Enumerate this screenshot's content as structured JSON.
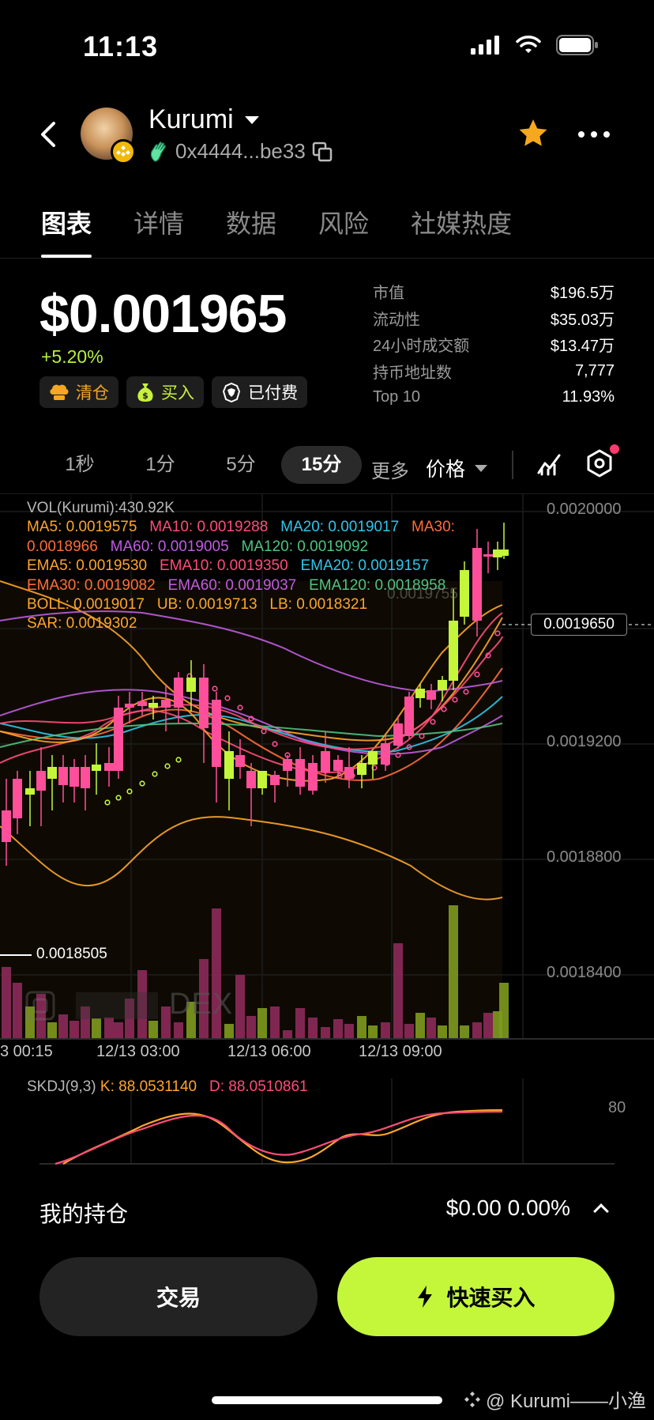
{
  "status_bar": {
    "time": "11:13"
  },
  "header": {
    "token_name": "Kurumi",
    "address": "0x4444...be33"
  },
  "tabs": [
    {
      "label": "图表",
      "active": true
    },
    {
      "label": "详情"
    },
    {
      "label": "数据"
    },
    {
      "label": "风险"
    },
    {
      "label": "社媒热度"
    }
  ],
  "price": {
    "value": "$0.001965",
    "change": "+5.20%"
  },
  "badges": {
    "clear": "清仓",
    "buy": "买入",
    "paid": "已付费"
  },
  "stats": [
    {
      "label": "市值",
      "value": "$196.5万"
    },
    {
      "label": "流动性",
      "value": "$35.03万"
    },
    {
      "label": "24小时成交额",
      "value": "$13.47万"
    },
    {
      "label": "持币地址数",
      "value": "7,777"
    },
    {
      "label": "Top 10",
      "value": "11.93%"
    }
  ],
  "time_ranges": [
    {
      "label": "1秒"
    },
    {
      "label": "1分"
    },
    {
      "label": "5分"
    },
    {
      "label": "15分",
      "active": true
    }
  ],
  "more_label": "更多",
  "price_select": "价格",
  "indicators": {
    "vol": "VOL(Kurumi):430.92K",
    "ma5": "MA5: 0.0019575",
    "ma10": "MA10: 0.0019288",
    "ma20": "MA20: 0.0019017",
    "ma30_a": "MA30:",
    "ma30_b": "0.0018966",
    "ma60": "MA60: 0.0019005",
    "ma120": "MA120: 0.0019092",
    "ema5": "EMA5: 0.0019530",
    "ema10": "EMA10: 0.0019350",
    "ema20": "EMA20: 0.0019157",
    "ema30": "EMA30: 0.0019082",
    "ema60": "EMA60: 0.0019037",
    "ema120": "EMA120: 0.0018958",
    "boll": "BOLL: 0.0019017",
    "ub": "UB: 0.0019713",
    "lb": "LB: 0.0018321",
    "sar": "SAR: 0.0019302",
    "skdj_label": "SKDJ(9,3)",
    "skdj_k": "K: 88.0531140",
    "skdj_d": "D: 88.0510861"
  },
  "colors": {
    "up": "#c4f73a",
    "down": "#ff4f9a",
    "ma5": "#ffa629",
    "ma10": "#ff4d7a",
    "ma20": "#2fc6e8",
    "ma30": "#ff6d3a",
    "ma60": "#c05ce0",
    "ma120": "#4fc380"
  },
  "chart_data": {
    "type": "candlestick",
    "y_ticks": [
      "0.0020000",
      "0.0019200",
      "0.0018800",
      "0.0018400"
    ],
    "x_ticks": [
      "3 00:15",
      "12/13 03:00",
      "12/13 06:00",
      "12/13 09:00"
    ],
    "current_price": "0.0019650",
    "low_marker": "0.0018505",
    "high_marker": "0.0019755",
    "skdj_level": "80",
    "dex_watermark": "DEX"
  },
  "holdings": {
    "label": "我的持仓",
    "value": "$0.00 0.00%"
  },
  "actions": {
    "trade": "交易",
    "quick_buy": "快速买入"
  },
  "watermark": "@ Kurumi——小渔"
}
